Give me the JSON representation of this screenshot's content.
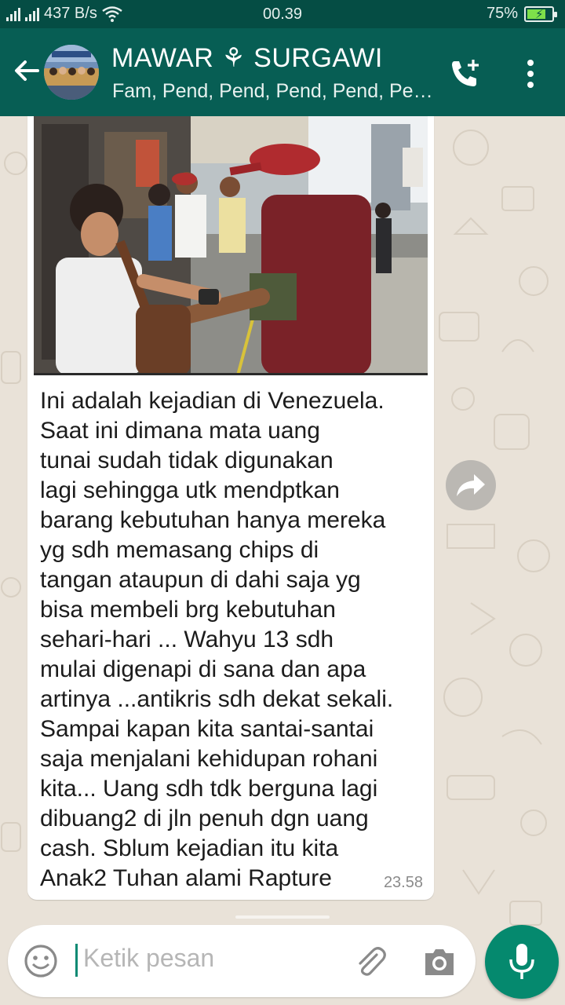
{
  "status_bar": {
    "network_speed": "437 B/s",
    "time": "00.39",
    "battery": "75%",
    "battery_level": 0.75
  },
  "header": {
    "title": "MAWAR ⚘ SURGAWI",
    "subtitle": "Fam, Pend, Pend, Pend, Pend, Pe…",
    "icons": [
      "back-arrow-icon",
      "group-avatar",
      "add-call-icon",
      "more-vert-icon"
    ]
  },
  "message": {
    "text": "Ini adalah kejadian di Venezuela.\nSaat ini dimana mata uang\ntunai sudah tidak digunakan\nlagi sehingga utk mendptkan\nbarang kebutuhan hanya mereka\nyg sdh memasang chips di\ntangan ataupun di dahi saja yg\nbisa membeli brg kebutuhan\nsehari-hari ... Wahyu 13 sdh\nmulai digenapi di sana dan apa\nartinya ...antikris sdh dekat sekali.\nSampai kapan kita santai-santai\nsaja menjalani kehidupan rohani\nkita... Uang sdh tdk berguna lagi\ndibuang2 di jln penuh dgn uang\ncash. Sblum kejadian itu kita\nAnak2 Tuhan alami Rapture",
    "time": "23.58"
  },
  "composer": {
    "placeholder": "Ketik pesan"
  },
  "colors": {
    "header": "#075e54",
    "status_bar": "#054d44",
    "accent": "#05896e",
    "background": "#e9e2d8"
  }
}
